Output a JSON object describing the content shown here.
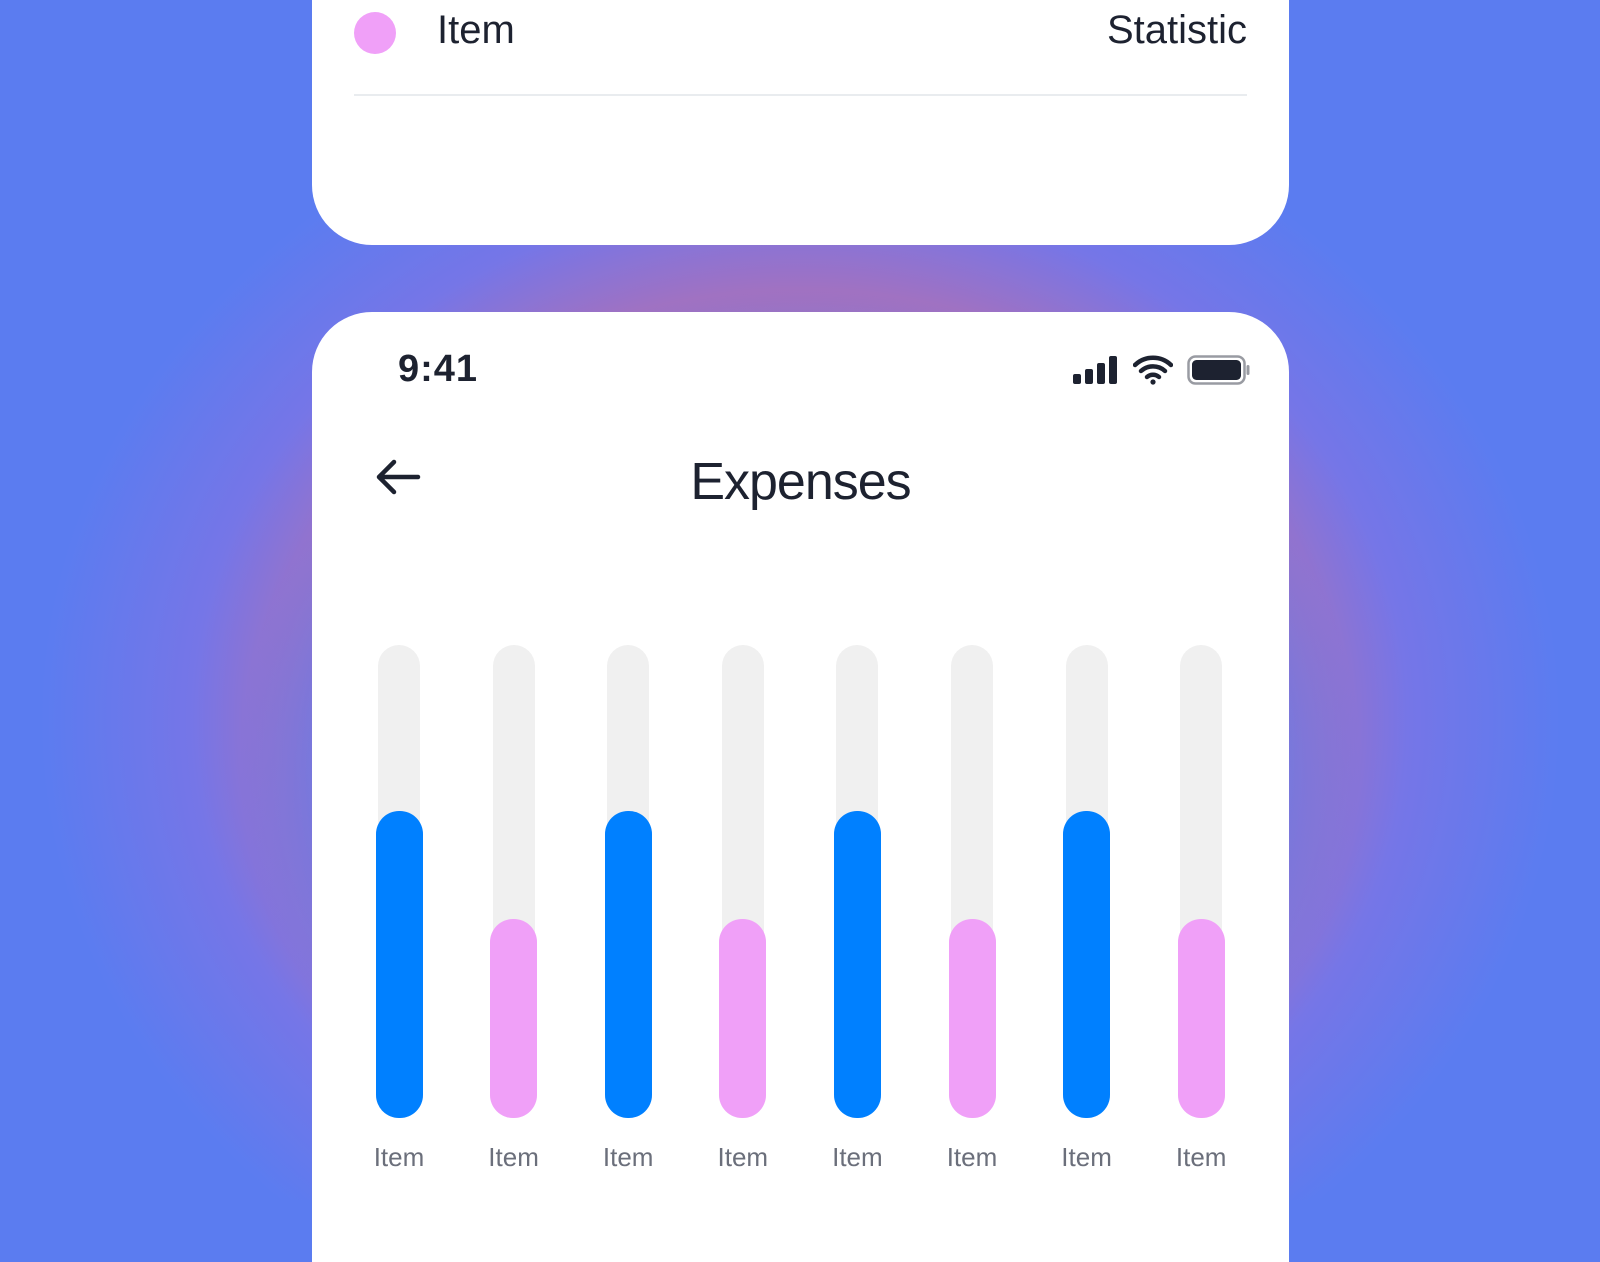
{
  "legend": {
    "label": "Item",
    "statistic": "Statistic",
    "color": "#f0a0f8"
  },
  "status_bar": {
    "time": "9:41",
    "icons": [
      "signal-icon",
      "wifi-icon",
      "battery-icon"
    ]
  },
  "header": {
    "back_icon": "arrow-left-icon",
    "title": "Expenses"
  },
  "colors": {
    "primary": "#0080ff",
    "secondary": "#f0a0f8",
    "track": "#f0f0f0"
  },
  "chart_data": {
    "type": "bar",
    "categories": [
      "Item",
      "Item",
      "Item",
      "Item",
      "Item",
      "Item",
      "Item",
      "Item"
    ],
    "values": [
      0.65,
      0.42,
      0.65,
      0.42,
      0.65,
      0.42,
      0.65,
      0.42
    ],
    "bar_colors": [
      "#0080ff",
      "#f0a0f8",
      "#0080ff",
      "#f0a0f8",
      "#0080ff",
      "#f0a0f8",
      "#0080ff",
      "#f0a0f8"
    ],
    "ylim": [
      0,
      1
    ],
    "grid": false
  }
}
